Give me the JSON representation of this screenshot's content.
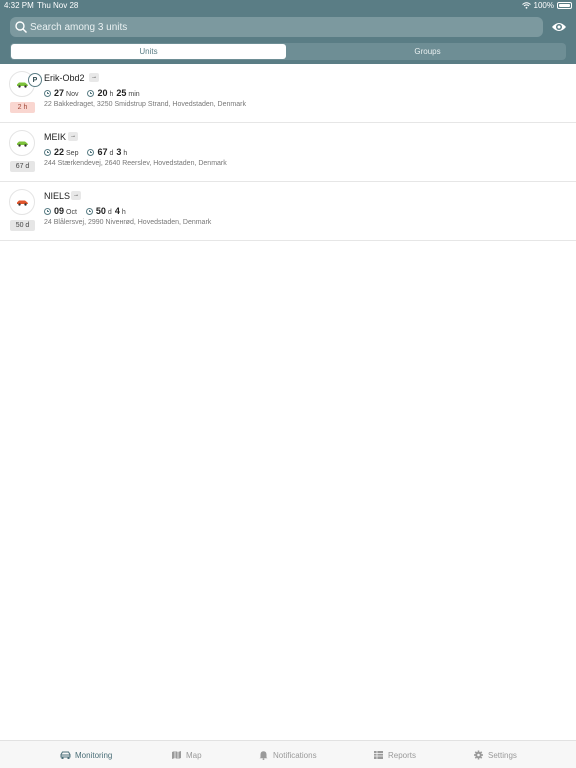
{
  "status_bar": {
    "time": "4:32 PM",
    "date": "Thu Nov 28",
    "battery": "100%"
  },
  "search": {
    "placeholder": "Search among 3 units"
  },
  "segments": {
    "units": "Units",
    "groups": "Groups"
  },
  "units": [
    {
      "name": "Erik-Obd2",
      "parking_badge": "P",
      "age": "2 h",
      "age_style": "red",
      "date_day": "27",
      "date_month": "Nov",
      "dur_a": "20",
      "dur_a_unit": "h",
      "dur_b": "25",
      "dur_b_unit": "min",
      "address": "22 Bakkedraget, 3250 Smidstrup Strand, Hovedstaden, Denmark",
      "car_color": "#7cc23a"
    },
    {
      "name": "MEIK",
      "age": "67 d",
      "age_style": "grey",
      "date_day": "22",
      "date_month": "Sep",
      "dur_a": "67",
      "dur_a_unit": "d",
      "dur_b": "3",
      "dur_b_unit": "h",
      "address": "244 Stærkendevej, 2640 Reerslev, Hovedstaden, Denmark",
      "car_color": "#7cc23a"
    },
    {
      "name": "NIELS",
      "age": "50 d",
      "age_style": "grey",
      "date_day": "09",
      "date_month": "Oct",
      "dur_a": "50",
      "dur_a_unit": "d",
      "dur_b": "4",
      "dur_b_unit": "h",
      "address": "24 Blålersvej, 2990 Nivенrød, Hovedstaden, Denmark",
      "car_color": "#e0552c"
    }
  ],
  "tabs": {
    "monitoring": "Monitoring",
    "map": "Map",
    "notifications": "Notifications",
    "reports": "Reports",
    "settings": "Settings"
  },
  "colors": {
    "header": "#5a7d85",
    "active_tab": "#4b6f78"
  }
}
